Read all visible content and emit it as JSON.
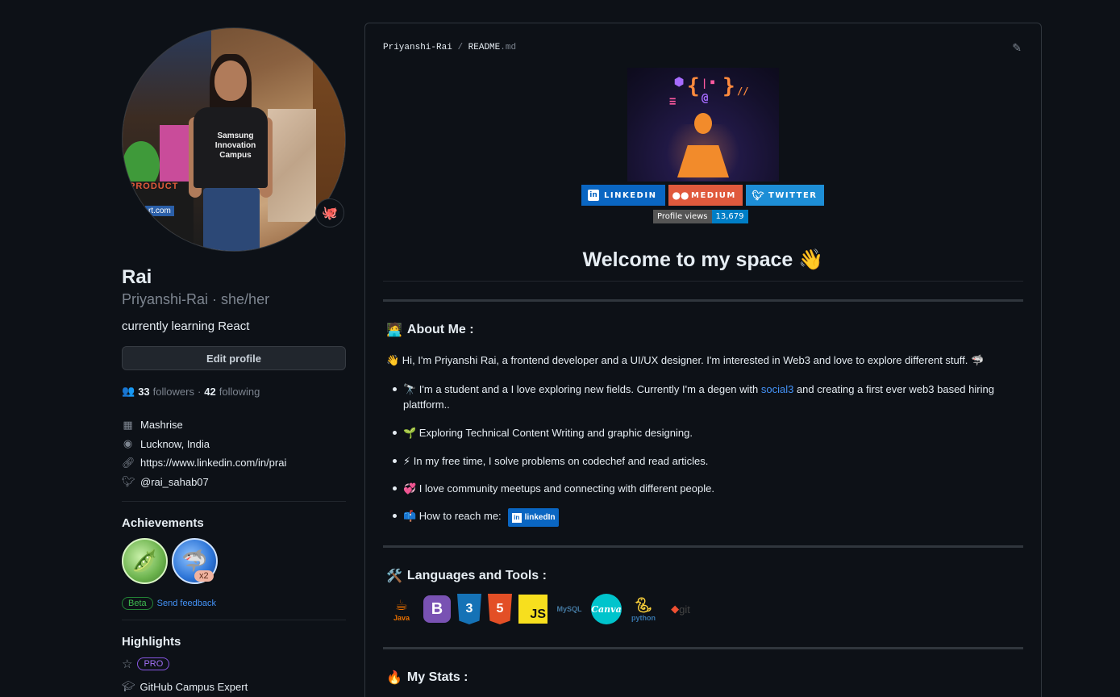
{
  "profile": {
    "name": "Rai",
    "login": "Priyanshi-Rai · she/her",
    "bio": "currently learning React",
    "edit_label": "Edit profile",
    "followers_count": "33",
    "followers_label": "followers",
    "dot": "·",
    "following_count": "42",
    "following_label": "following",
    "company": "Mashrise",
    "location": "Lucknow, India",
    "website": "https://www.linkedin.com/in/prai",
    "twitter": "@rai_sahab07",
    "avatar_text": {
      "shirt": "Samsung Innovation Campus",
      "product": "PRODUCT",
      "url": "rt.com"
    }
  },
  "achievements": {
    "title": "Achievements",
    "badge_1_icon": "peas-icon",
    "badge_2_icon": "shark-icon",
    "multiplier": "x2",
    "beta": "Beta",
    "feedback": "Send feedback"
  },
  "highlights": {
    "title": "Highlights",
    "pro": "PRO",
    "campus_expert": "GitHub Campus Expert"
  },
  "readme": {
    "crumb_user": "Priyanshi-Rai",
    "crumb_sep": "/",
    "crumb_file": "README",
    "crumb_ext": ".md",
    "badges": {
      "linkedin": "LINKEDIN",
      "medium": "MEDIUM",
      "twitter": "TWITTER"
    },
    "views_label": "Profile views",
    "views_count": "13,679",
    "welcome": "Welcome to my space 👋",
    "about_title": "About Me :",
    "about_emoji": "🧑‍💻",
    "intro": "👋 Hi, I'm Priyanshi Rai, a frontend developer and a UI/UX designer. I'm interested in Web3 and love to explore different stuff. 🦈",
    "bullets": {
      "b1_pre": "🔭  I'm a student and a I love exploring new fields. Currently I'm a degen with ",
      "b1_link": "social3",
      "b1_post": " and creating a first ever web3 based hiring plattform..",
      "b2": "🌱  Exploring Technical Content Writing and graphic designing.",
      "b3": "⚡  In my free time, I solve problems on codechef and read articles.",
      "b4": "💞  I love community meetups and connecting with different people.",
      "b5": "📫 How to reach me:",
      "b5_badge": "linkedIn"
    },
    "tools_title": "Languages and Tools :",
    "tools_emoji": "🛠️",
    "tools": {
      "java": "Java",
      "bootstrap": "B",
      "css": "3",
      "html": "5",
      "js": "JS",
      "mysql": "MySQL",
      "canva": "Canva",
      "python": "python",
      "git": "git"
    },
    "stats_title": "My Stats :",
    "stats_emoji": "🔥"
  },
  "colors": {
    "background": "#0d1117",
    "link": "#4493f8",
    "linkedin": "#0a66c2",
    "medium": "#e05a3d",
    "twitter": "#1d8ed6"
  }
}
